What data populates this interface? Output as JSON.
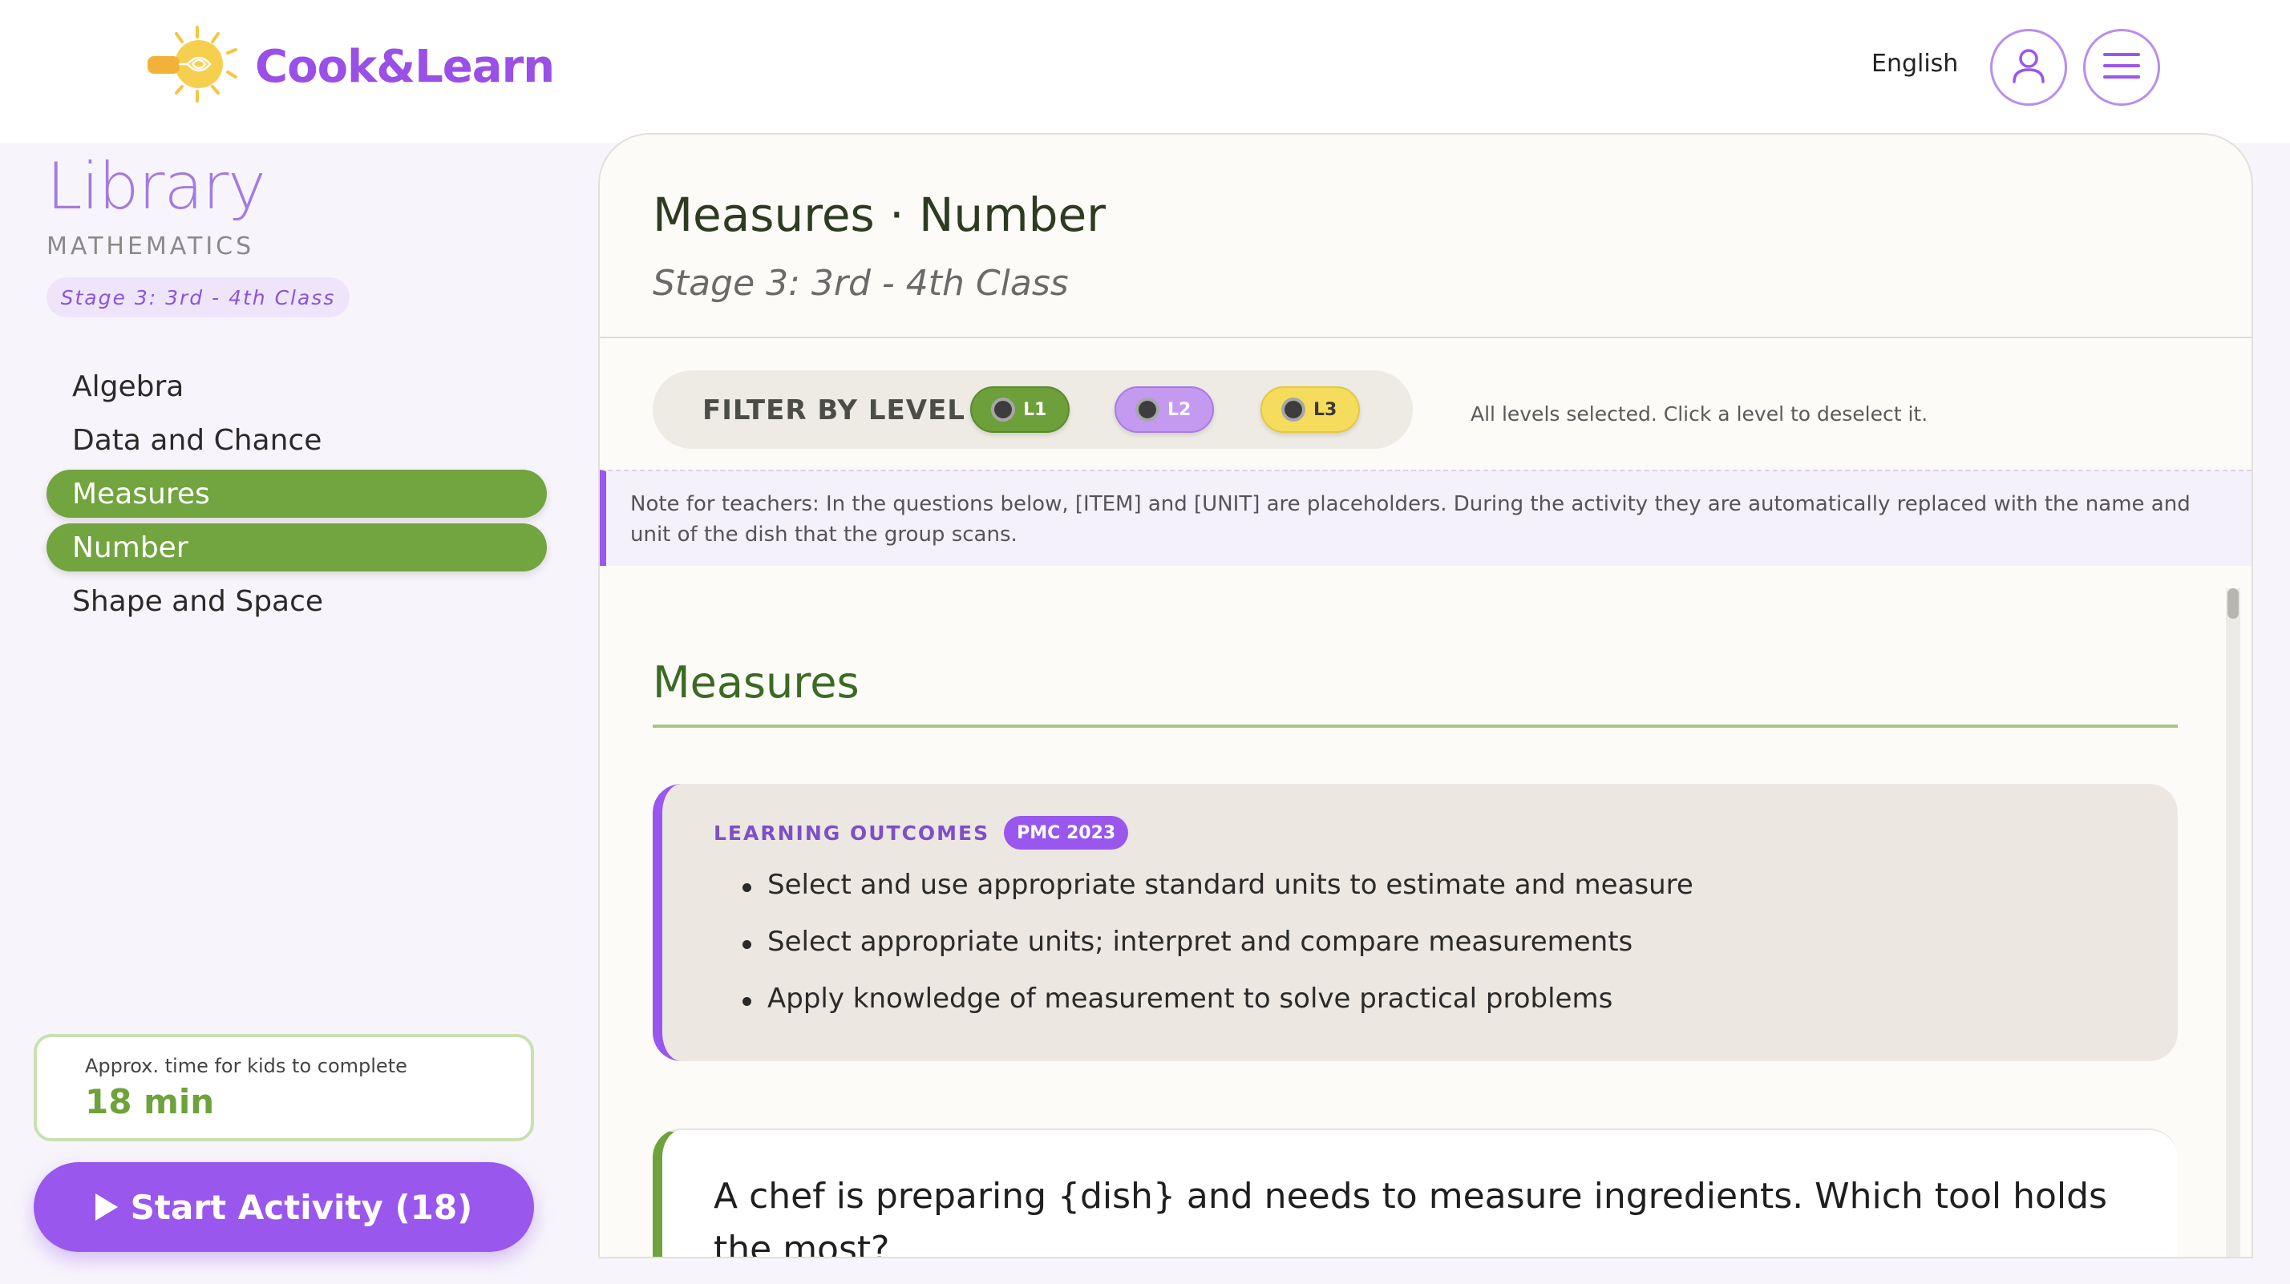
{
  "header": {
    "brand": "Cook&Learn",
    "language": "English",
    "icons": {
      "logo": "lightbulb-whisk-logo",
      "user": "user-icon",
      "menu": "hamburger-menu-icon"
    }
  },
  "sidebar": {
    "title": "Library",
    "subject": "MATHEMATICS",
    "stage": "Stage 3: 3rd - 4th Class",
    "items": [
      {
        "label": "Algebra",
        "active": false
      },
      {
        "label": "Data and Chance",
        "active": false
      },
      {
        "label": "Measures",
        "active": true
      },
      {
        "label": "Number",
        "active": true
      },
      {
        "label": "Shape and Space",
        "active": false
      }
    ],
    "time_label": "Approx. time for kids to complete",
    "time_value": "18 min",
    "start_label": "Start Activity (18)"
  },
  "main": {
    "title": "Measures · Number",
    "subtitle": "Stage 3: 3rd - 4th Class",
    "filter": {
      "label": "FILTER BY LEVEL",
      "levels": [
        "L1",
        "L2",
        "L3"
      ],
      "hint": "All levels selected. Click a level to deselect it."
    },
    "note": "Note for teachers: In the questions below, [ITEM] and [UNIT] are placeholders. During the activity they are automatically replaced with the name and unit of the dish that the group scans.",
    "section": {
      "title": "Measures",
      "outcomes_label": "LEARNING OUTCOMES",
      "outcomes_badge": "PMC 2023",
      "outcomes": [
        "Select and use appropriate standard units to estimate and measure",
        "Select appropriate units; interpret and compare measurements",
        "Apply knowledge of measurement to solve practical problems"
      ],
      "question": "A chef is preparing {dish} and needs to measure ingredients. Which tool holds the most?"
    }
  },
  "colors": {
    "brand_purple": "#9957ee",
    "level1_green": "#6d9f3a",
    "level2_purple": "#c39af0",
    "level3_yellow": "#f6dc5c",
    "active_nav": "#72a43f"
  }
}
